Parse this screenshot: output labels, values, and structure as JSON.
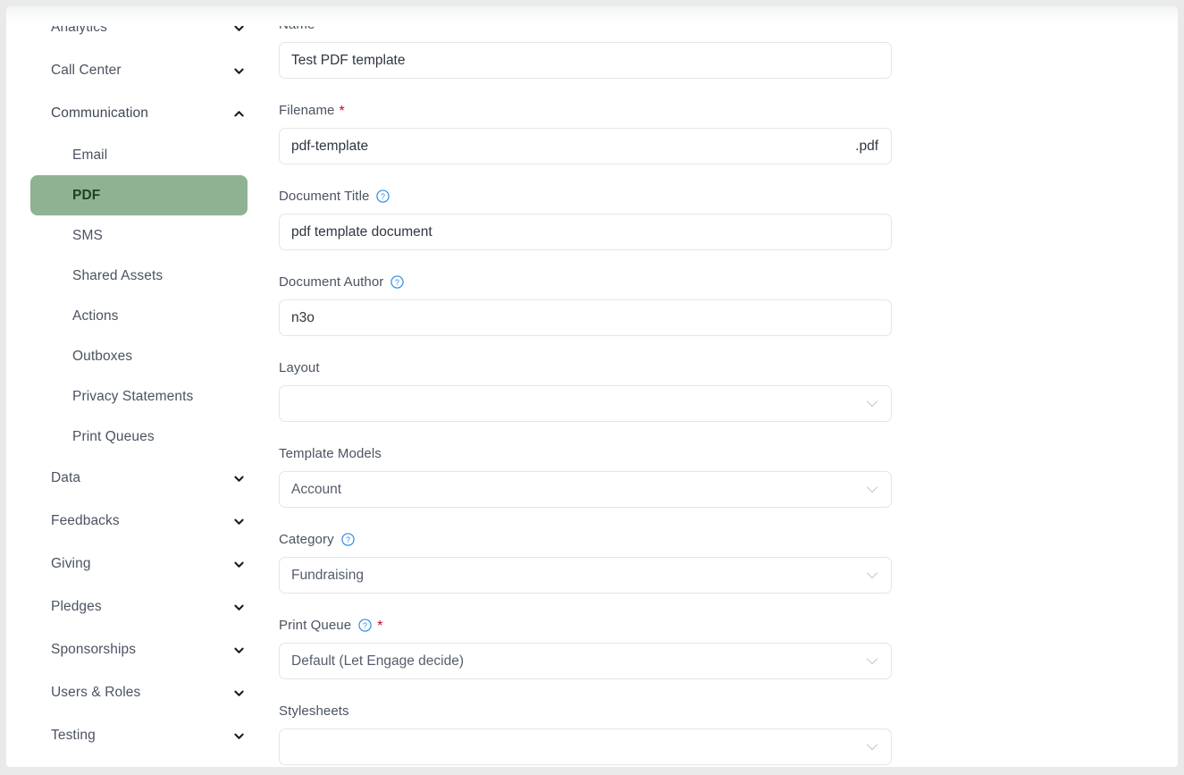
{
  "sidebar": {
    "items": [
      {
        "label": "Analytics",
        "type": "group",
        "expanded": false,
        "icon": "chevron-down-icon"
      },
      {
        "label": "Call Center",
        "type": "group",
        "expanded": false,
        "icon": "chevron-down-icon"
      },
      {
        "label": "Communication",
        "type": "group",
        "expanded": true,
        "icon": "chevron-up-icon"
      },
      {
        "label": "Email",
        "type": "child",
        "active": false
      },
      {
        "label": "PDF",
        "type": "child",
        "active": true
      },
      {
        "label": "SMS",
        "type": "child",
        "active": false
      },
      {
        "label": "Shared Assets",
        "type": "child",
        "active": false
      },
      {
        "label": "Actions",
        "type": "child",
        "active": false
      },
      {
        "label": "Outboxes",
        "type": "child",
        "active": false
      },
      {
        "label": "Privacy Statements",
        "type": "child",
        "active": false
      },
      {
        "label": "Print Queues",
        "type": "child",
        "active": false
      },
      {
        "label": "Data",
        "type": "group",
        "expanded": false,
        "icon": "chevron-down-icon"
      },
      {
        "label": "Feedbacks",
        "type": "group",
        "expanded": false,
        "icon": "chevron-down-icon"
      },
      {
        "label": "Giving",
        "type": "group",
        "expanded": false,
        "icon": "chevron-down-icon"
      },
      {
        "label": "Pledges",
        "type": "group",
        "expanded": false,
        "icon": "chevron-down-icon"
      },
      {
        "label": "Sponsorships",
        "type": "group",
        "expanded": false,
        "icon": "chevron-down-icon"
      },
      {
        "label": "Users & Roles",
        "type": "group",
        "expanded": false,
        "icon": "chevron-down-icon"
      },
      {
        "label": "Testing",
        "type": "group",
        "expanded": false,
        "icon": "chevron-down-icon"
      }
    ],
    "active_color": "#8fb292",
    "active_text_color": "#1f4223"
  },
  "form": {
    "name": {
      "label": "Name",
      "required_marker": "*",
      "value": "Test PDF template",
      "placeholder": ""
    },
    "filename": {
      "label": "Filename",
      "required_marker": "*",
      "value": "pdf-template",
      "suffix": ".pdf",
      "placeholder": ""
    },
    "document_title": {
      "label": "Document Title",
      "help_icon": "help-circle-icon",
      "value": "pdf template document",
      "placeholder": ""
    },
    "document_author": {
      "label": "Document Author",
      "help_icon": "help-circle-icon",
      "value": "n3o",
      "placeholder": ""
    },
    "layout": {
      "label": "Layout",
      "value": "",
      "placeholder": ""
    },
    "template_models": {
      "label": "Template Models",
      "value": "Account",
      "placeholder": ""
    },
    "category": {
      "label": "Category",
      "help_icon": "help-circle-icon",
      "value": "Fundraising",
      "placeholder": ""
    },
    "print_queue": {
      "label": "Print Queue",
      "help_icon": "help-circle-icon",
      "required_marker": "*",
      "value": "Default (Let Engage decide)",
      "placeholder": ""
    },
    "stylesheets": {
      "label": "Stylesheets",
      "value": "",
      "placeholder": ""
    }
  },
  "colors": {
    "accent_green": "#8fb292",
    "required_red": "#d0021b",
    "help_blue": "#2f8de4",
    "border_gray": "#e3e5e7",
    "page_background": "#eaeaea"
  }
}
